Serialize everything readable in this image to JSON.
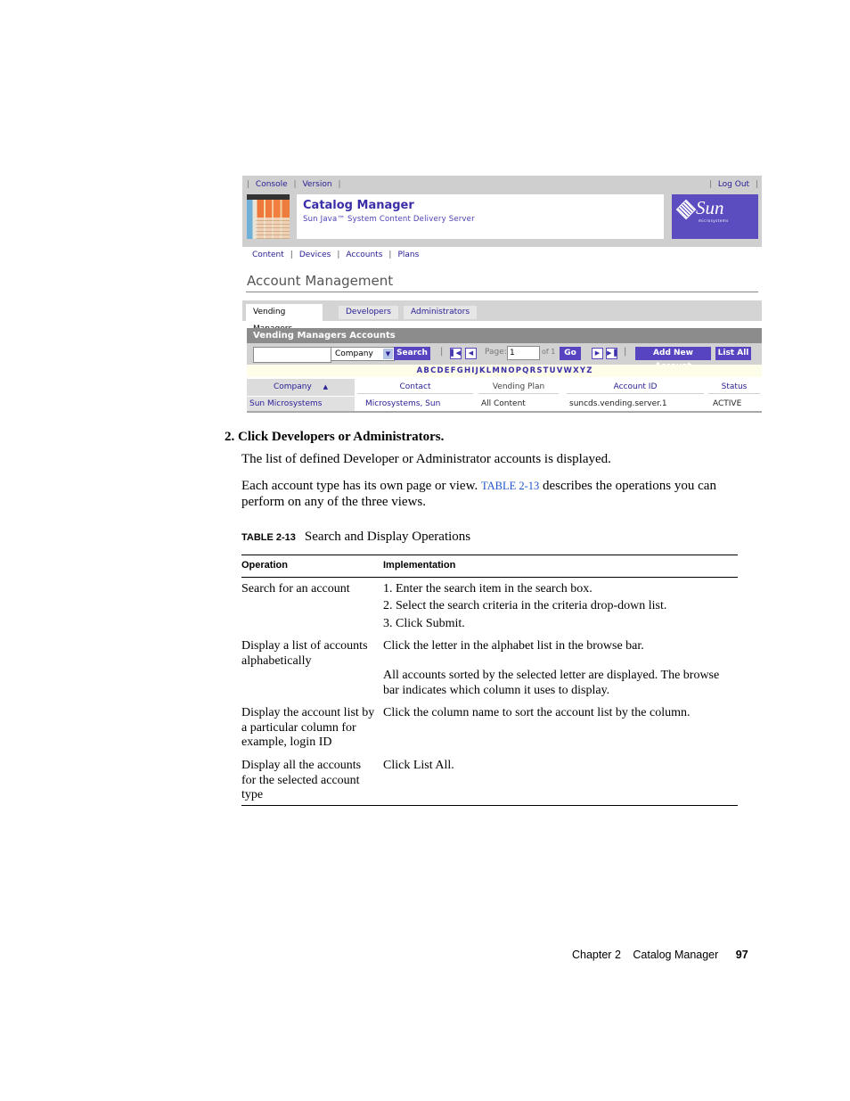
{
  "screenshot": {
    "top_nav": {
      "left_links": [
        "Console",
        "Version"
      ],
      "right_link": "Log Out"
    },
    "banner": {
      "title": "Catalog Manager",
      "subtitle": "Sun Java™ System Content Delivery Server",
      "logo_text": "Sun",
      "logo_subtext": "microsystems"
    },
    "sub_nav": [
      "Content",
      "Devices",
      "Accounts",
      "Plans"
    ],
    "page_heading": "Account Management",
    "tabs": [
      {
        "label": "Vending Managers",
        "active": true
      },
      {
        "label": "Developers",
        "active": false
      },
      {
        "label": "Administrators",
        "active": false
      }
    ],
    "section_title": "Vending Managers Accounts",
    "toolbar": {
      "search_value": "",
      "criteria_selected": "Company",
      "search_button": "Search",
      "page_label": "Page:",
      "page_value": "1",
      "page_of": "of 1",
      "go_button": "Go",
      "add_button": "Add New Account",
      "list_all_button": "List All"
    },
    "alphabet": [
      "A",
      "B",
      "C",
      "D",
      "E",
      "F",
      "G",
      "H",
      "I",
      "J",
      "K",
      "L",
      "M",
      "N",
      "O",
      "P",
      "Q",
      "R",
      "S",
      "T",
      "U",
      "V",
      "W",
      "X",
      "Y",
      "Z"
    ],
    "table": {
      "columns": [
        "Company",
        "Contact",
        "Vending Plan",
        "Account ID",
        "Status"
      ],
      "sorted_column": "Company",
      "sort_direction": "ascending",
      "rows": [
        [
          "Sun Microsystems",
          "Microsystems, Sun",
          "All Content",
          "suncds.vending.server.1",
          "ACTIVE"
        ]
      ]
    },
    "colors": {
      "accent": "#5644c1",
      "link": "#2a2096",
      "bar_gray": "#8c8c8c",
      "alpha_bg": "#fefde9"
    }
  },
  "doc": {
    "step_number": "2.",
    "step_text": "Click Developers or Administrators.",
    "para1": "The list of defined Developer or Administrator accounts is displayed.",
    "para2_before": "Each account type has its own page or view. ",
    "para2_link": "TABLE 2-13",
    "para2_after": " describes the operations you can perform on any of the three views.",
    "table_label": "TABLE 2-13",
    "table_title": "Search and Display Operations",
    "table_headers": [
      "Operation",
      "Implementation"
    ],
    "table_rows": [
      {
        "operation": "Search for an account",
        "implementation": [
          "1. Enter the search item in the search box.",
          "2. Select the search criteria in the criteria drop-down list.",
          "3. Click Submit."
        ]
      },
      {
        "operation": "Display a list of accounts alphabetically",
        "implementation": [
          "Click the letter in the alphabet list in the browse bar.",
          "All accounts sorted by the selected letter are displayed. The browse bar indicates which column it uses to display."
        ]
      },
      {
        "operation": "Display the account list by a particular column for example, login ID",
        "implementation": [
          "Click the column name to sort the account list by the column."
        ]
      },
      {
        "operation": "Display all the accounts for the selected account type",
        "implementation": [
          "Click List All."
        ]
      }
    ],
    "footer": {
      "chapter": "Chapter 2",
      "chapter_title": "Catalog Manager",
      "page_number": "97"
    }
  }
}
